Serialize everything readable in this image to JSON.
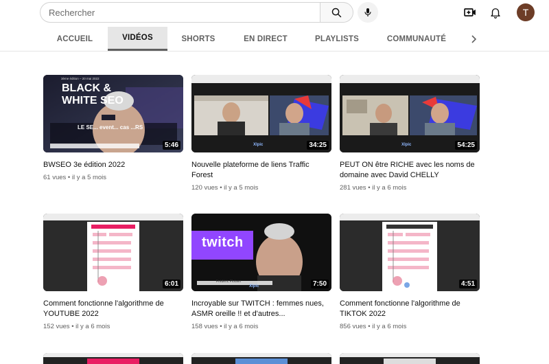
{
  "search": {
    "placeholder": "Rechercher"
  },
  "header": {
    "avatar_letter": "T"
  },
  "tabs": [
    {
      "label": "ACCUEIL"
    },
    {
      "label": "VIDÉOS"
    },
    {
      "label": "SHORTS"
    },
    {
      "label": "EN DIRECT"
    },
    {
      "label": "PLAYLISTS"
    },
    {
      "label": "COMMUNAUTÉ"
    }
  ],
  "videos": [
    {
      "title": "BWSEO 3e édition 2022",
      "views": "61 vues",
      "age": "il y a 5 mois",
      "duration": "5:46",
      "thumb_text": "BLACK & WHITE SEO",
      "thumb_subtext": "3ème édition – 20 mai 2022",
      "thumb_caption": "LE SE... event... cas ...RS"
    },
    {
      "title": "Nouvelle plateforme de liens Traffic Forest",
      "views": "120 vues",
      "age": "il y a 5 mois",
      "duration": "34:25",
      "thumb_logo": "Xlpic"
    },
    {
      "title": "PEUT ON être RICHE avec les noms de domaine avec David CHELLY",
      "views": "281 vues",
      "age": "il y a 6 mois",
      "duration": "54:25",
      "thumb_logo": "Xlpic"
    },
    {
      "title": "Comment fonctionne l'algorithme de YOUTUBE 2022",
      "views": "152 vues",
      "age": "il y a 6 mois",
      "duration": "6:01"
    },
    {
      "title": "Incroyable sur TWITCH : femmes nues, ASMR oreille !! et d'autres...",
      "views": "158 vues",
      "age": "il y a 6 mois",
      "duration": "7:50",
      "thumb_text": "twitch",
      "thumb_caption": "Frédéric Ploisen",
      "thumb_logo": "Xlpic"
    },
    {
      "title": "Comment fonctionne l'algorithme de TIKTOK 2022",
      "views": "856 vues",
      "age": "il y a 6 mois",
      "duration": "4:51"
    }
  ],
  "meta_separator": "•",
  "colors": {
    "accent_pink": "#e91e63",
    "avatar": "#6d3d27",
    "twitch_purple": "#9146ff",
    "tab_active_bg": "#e6e6e6"
  }
}
